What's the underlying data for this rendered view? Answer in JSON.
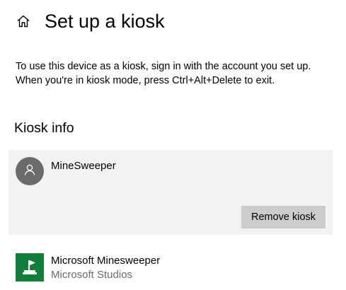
{
  "header": {
    "home_icon": "home-icon",
    "title": "Set up a kiosk"
  },
  "description": {
    "line1": "To use this device as a kiosk, sign in with the account you set up.",
    "line2": "When you're in kiosk mode, press Ctrl+Alt+Delete to exit."
  },
  "kiosk_info": {
    "heading": "Kiosk info",
    "account": {
      "avatar_icon": "person-icon",
      "name": "MineSweeper"
    },
    "remove_label": "Remove kiosk",
    "app": {
      "icon": "minesweeper-app-icon",
      "name": "Microsoft Minesweeper",
      "publisher": "Microsoft Studios"
    }
  },
  "colors": {
    "card_background": "#f2f2f2",
    "button_background": "#cccccc",
    "avatar_background": "#6b6b6b",
    "app_tile_background": "#117e3a",
    "secondary_text": "#6b6b6b"
  }
}
